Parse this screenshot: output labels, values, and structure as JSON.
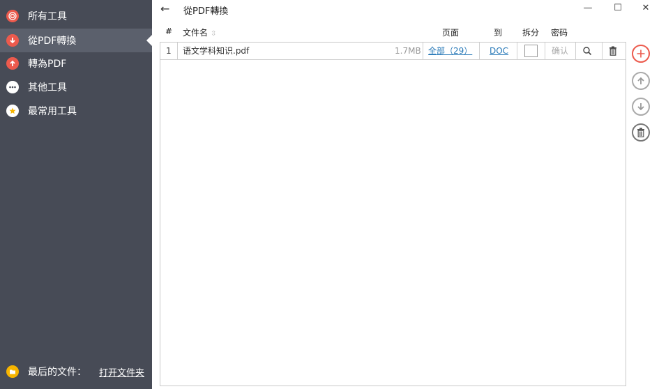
{
  "sidebar": {
    "items": [
      {
        "label": "所有工具",
        "icon": "target-icon",
        "color": "#ec5a4d"
      },
      {
        "label": "從PDF轉換",
        "icon": "arrow-down-icon",
        "color": "#ec5a4d",
        "active": true
      },
      {
        "label": "轉為PDF",
        "icon": "arrow-up-icon",
        "color": "#ec5a4d"
      },
      {
        "label": "其他工具",
        "icon": "more-icon",
        "color": "#474b56"
      },
      {
        "label": "最常用工具",
        "icon": "star-icon",
        "color": "#f7b500"
      }
    ],
    "footer": {
      "recent_label": "最后的文件：",
      "open_folder_label": "打开文件夹"
    }
  },
  "header": {
    "back_glyph": "←",
    "title": "從PDF轉換",
    "minimize_glyph": "—",
    "maximize_glyph": "☐",
    "close_glyph": "✕"
  },
  "columns": {
    "index": "#",
    "filename": "文件名",
    "pages": "页面",
    "to": "到",
    "split": "拆分",
    "password": "密码"
  },
  "rows": [
    {
      "index": "1",
      "filename": "语文学科知识.pdf",
      "size": "1.7MB",
      "pages": "全部（29）",
      "to": "DOC",
      "split": false,
      "password_placeholder": "确认"
    }
  ],
  "colors": {
    "sidebar_bg": "#474b56",
    "sidebar_active": "#5b606c",
    "accent_red": "#ec5a4d",
    "accent_yellow": "#f7b500",
    "link": "#2a7ab8"
  }
}
